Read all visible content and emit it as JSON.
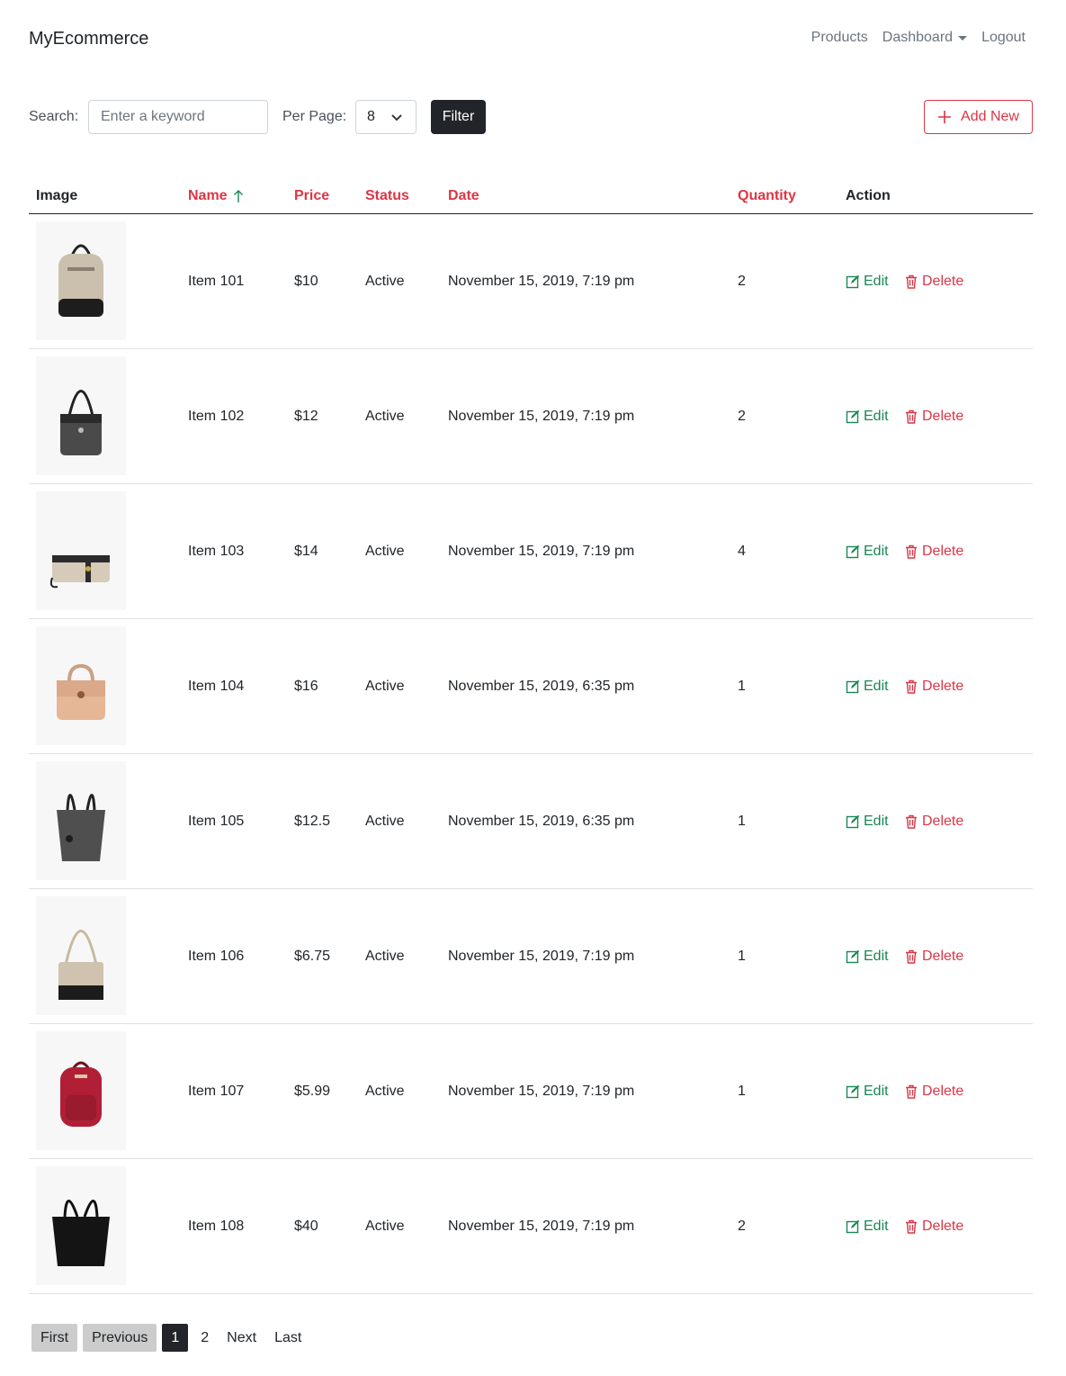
{
  "brand": "MyEcommerce",
  "nav": {
    "products": "Products",
    "dashboard": "Dashboard",
    "logout": "Logout"
  },
  "toolbar": {
    "search_label": "Search:",
    "search_placeholder": "Enter a keyword",
    "per_page_label": "Per Page:",
    "per_page_value": "8",
    "filter_label": "Filter",
    "add_new_label": "Add New"
  },
  "table": {
    "headers": {
      "image": "Image",
      "name": "Name",
      "price": "Price",
      "status": "Status",
      "date": "Date",
      "quantity": "Quantity",
      "action": "Action"
    },
    "edit_label": "Edit",
    "delete_label": "Delete",
    "rows": [
      {
        "name": "Item 101",
        "price": "$10",
        "status": "Active",
        "date": "November 15, 2019, 7:19 pm",
        "quantity": "2",
        "image": "beige-backpack"
      },
      {
        "name": "Item 102",
        "price": "$12",
        "status": "Active",
        "date": "November 15, 2019, 7:19 pm",
        "quantity": "2",
        "image": "grey-shoulder-bag"
      },
      {
        "name": "Item 103",
        "price": "$14",
        "status": "Active",
        "date": "November 15, 2019, 7:19 pm",
        "quantity": "4",
        "image": "beige-clutch"
      },
      {
        "name": "Item 104",
        "price": "$16",
        "status": "Active",
        "date": "November 15, 2019, 6:35 pm",
        "quantity": "1",
        "image": "peach-satchel"
      },
      {
        "name": "Item 105",
        "price": "$12.5",
        "status": "Active",
        "date": "November 15, 2019, 6:35 pm",
        "quantity": "1",
        "image": "grey-tote"
      },
      {
        "name": "Item 106",
        "price": "$6.75",
        "status": "Active",
        "date": "November 15, 2019, 7:19 pm",
        "quantity": "1",
        "image": "beige-chain-bag"
      },
      {
        "name": "Item 107",
        "price": "$5.99",
        "status": "Active",
        "date": "November 15, 2019, 7:19 pm",
        "quantity": "1",
        "image": "red-backpack"
      },
      {
        "name": "Item 108",
        "price": "$40",
        "status": "Active",
        "date": "November 15, 2019, 7:19 pm",
        "quantity": "2",
        "image": "black-tote"
      }
    ]
  },
  "pagination": {
    "first": "First",
    "previous": "Previous",
    "pages": [
      "1",
      "2"
    ],
    "next": "Next",
    "last": "Last"
  },
  "colors": {
    "accent": "#dc3545",
    "edit": "#198754",
    "dark": "#212529"
  }
}
